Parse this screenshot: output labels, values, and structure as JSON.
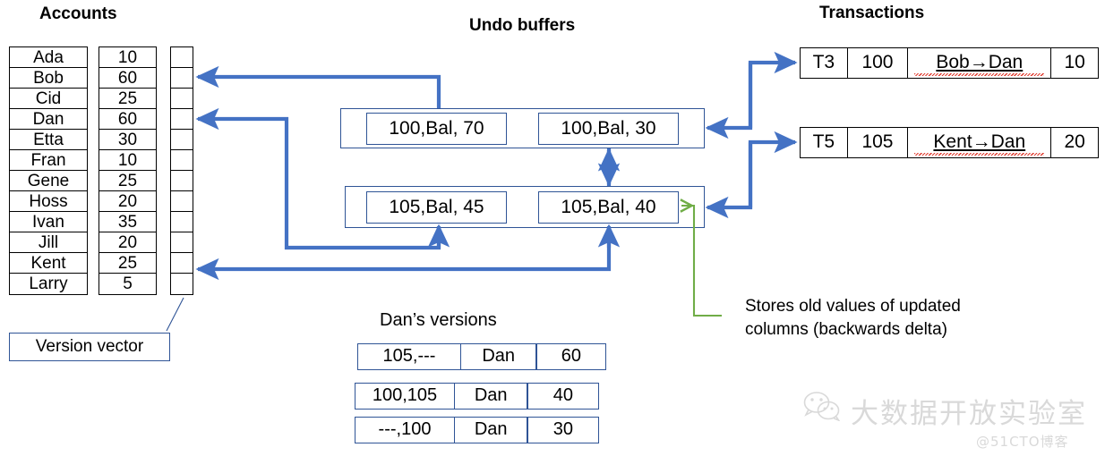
{
  "headings": {
    "accounts": "Accounts",
    "undo_buffers": "Undo buffers",
    "transactions": "Transactions",
    "dans_versions": "Dan’s versions"
  },
  "accounts": {
    "names": [
      "Ada",
      "Bob",
      "Cid",
      "Dan",
      "Etta",
      "Fran",
      "Gene",
      "Hoss",
      "Ivan",
      "Jill",
      "Kent",
      "Larry"
    ],
    "balances": [
      "10",
      "60",
      "25",
      "60",
      "30",
      "10",
      "25",
      "20",
      "35",
      "20",
      "25",
      "5"
    ],
    "version_vector_label": "Version vector",
    "version_vector_slots": 12
  },
  "undo_buffers": [
    {
      "left": "100,Bal, 70",
      "right": "100,Bal, 30"
    },
    {
      "left": "105,Bal, 45",
      "right": "105,Bal, 40"
    }
  ],
  "transactions": [
    {
      "id": "T3",
      "timestamp": "100",
      "operation": "Bob→Dan",
      "amount": "10"
    },
    {
      "id": "T5",
      "timestamp": "105",
      "operation": "Kent→Dan",
      "amount": "20"
    }
  ],
  "dans_versions": {
    "rows": [
      {
        "interval": "105,---",
        "account": "Dan",
        "value": "60"
      },
      {
        "interval": "100,105",
        "account": "Dan",
        "value": "40"
      },
      {
        "interval": "---,100",
        "account": "Dan",
        "value": "30"
      }
    ]
  },
  "annotation": {
    "line1": "Stores old values of updated",
    "line2": "columns (backwards delta)"
  },
  "watermark": {
    "main": "大数据开放实验室",
    "sub": "@51CTO博客"
  },
  "colors": {
    "arrow_blue": "#4472c4",
    "arrow_green": "#70ad47",
    "box_blue": "#2f5496",
    "text_black": "#000000",
    "watermark_gray": "#d9d9d9"
  }
}
